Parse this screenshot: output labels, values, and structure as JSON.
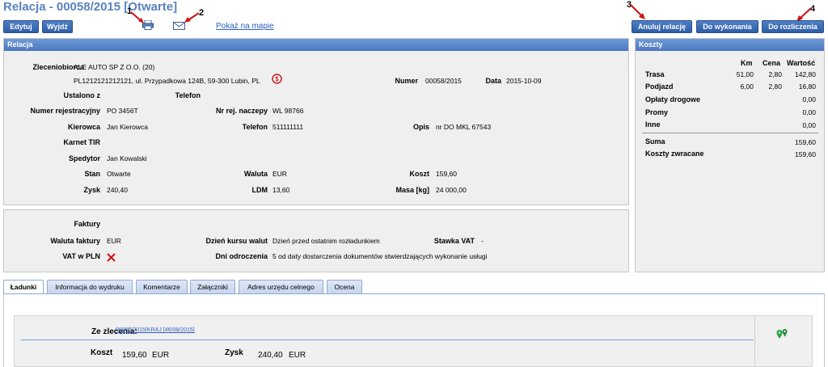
{
  "page": {
    "title": "Relacja - 00058/2015 [Otwarte]"
  },
  "toolbar": {
    "edit_label": "Edytuj",
    "exit_label": "Wyjdź",
    "map_link": "Pokaż na mapie",
    "cancel_label": "Anuluj relację",
    "todo_label": "Do wykonania",
    "settle_label": "Do rozliczenia",
    "print_icon": "printer-icon",
    "mail_icon": "envelope-icon"
  },
  "markers": [
    "1",
    "2",
    "3",
    "4"
  ],
  "colors": {
    "accent": "#4b78bf",
    "title": "#5a82c0",
    "annotation_arrow": "#d01010"
  },
  "relacja": {
    "header": "Relacja",
    "zleceniobiorca_label": "Zleceniobiorca",
    "zleceniobiorca_name": "ALE AUTO SP Z O.O. (20)",
    "zleceniobiorca_addr": "PL1212121212121, ul. Przypadkowa 124B, 59-300 Lubin, PL",
    "numer_label": "Numer",
    "numer_value": "00058/2015",
    "data_label": "Data",
    "data_value": "2015-10-09",
    "ustalono_label": "Ustalono z",
    "telefon_top_label": "Telefon",
    "nr_rej_label": "Numer rejestracyjny",
    "nr_rej_value": "PO 3456T",
    "nr_naczepy_label": "Nr rej. naczepy",
    "nr_naczepy_value": "WL 98766",
    "kierowca_label": "Kierowca",
    "kierowca_value": "Jan Kierowca",
    "telefon_label": "Telefon",
    "telefon_value": "511111111",
    "opis_label": "Opis",
    "opis_value": "nr DO MKL 67543",
    "karnet_label": "Karnet TIR",
    "spedytor_label": "Spedytor",
    "spedytor_value": "Jan Kowalski",
    "stan_label": "Stan",
    "stan_value": "Otwarte",
    "waluta_label": "Waluta",
    "waluta_value": "EUR",
    "koszt_label": "Koszt",
    "koszt_value": "159,60",
    "zysk_label": "Zysk",
    "zysk_value": "240,40",
    "ldm_label": "LDM",
    "ldm_value": "13,60",
    "masa_label": "Masa [kg]",
    "masa_value": "24 000,00"
  },
  "faktury": {
    "faktury_label": "Faktury",
    "waluta_faktury_label": "Waluta faktury",
    "waluta_faktury_value": "EUR",
    "dzien_kursu_label": "Dzień kursu walut",
    "dzien_kursu_value": "Dzień przed ostatnim rozładunkiem",
    "stawka_vat_label": "Stawka VAT",
    "stawka_vat_value": "-",
    "vat_pln_label": "VAT w PLN",
    "dni_odroczenia_label": "Dni odroczenia",
    "dni_odroczenia_value": "5 od daty dostarczenia dokumentów stwierdzających wykonanie usługi"
  },
  "koszty": {
    "header": "Koszty",
    "col_km": "Km",
    "col_cena": "Cena",
    "col_wartosc": "Wartość",
    "rows": [
      {
        "label": "Trasa",
        "km": "51,00",
        "cena": "2,80",
        "wartosc": "142,80"
      },
      {
        "label": "Podjazd",
        "km": "6,00",
        "cena": "2,80",
        "wartosc": "16,80"
      },
      {
        "label": "Opłaty drogowe",
        "km": "",
        "cena": "",
        "wartosc": "0,00"
      },
      {
        "label": "Promy",
        "km": "",
        "cena": "",
        "wartosc": "0,00"
      },
      {
        "label": "Inne",
        "km": "",
        "cena": "",
        "wartosc": "0,00"
      }
    ],
    "suma_label": "Suma",
    "suma_value": "159,60",
    "zwracane_label": "Koszty zwracane",
    "zwracane_value": "159,60"
  },
  "tabs": [
    "Ładunki",
    "Informacja do wydruku",
    "Komentarze",
    "Załączniki",
    "Adres urzędu celnego",
    "Ocena"
  ],
  "ladunki": {
    "ze_zlecenia_label": "Ze zlecenia:",
    "ze_zlecenia_link": "00060/2015/KRAJ [46/08/2015]",
    "koszt_label": "Koszt",
    "koszt_value": "159,60",
    "koszt_cur": "EUR",
    "zysk_label": "Zysk",
    "zysk_value": "240,40",
    "zysk_cur": "EUR",
    "pin_icon": "map-pin-icon"
  }
}
